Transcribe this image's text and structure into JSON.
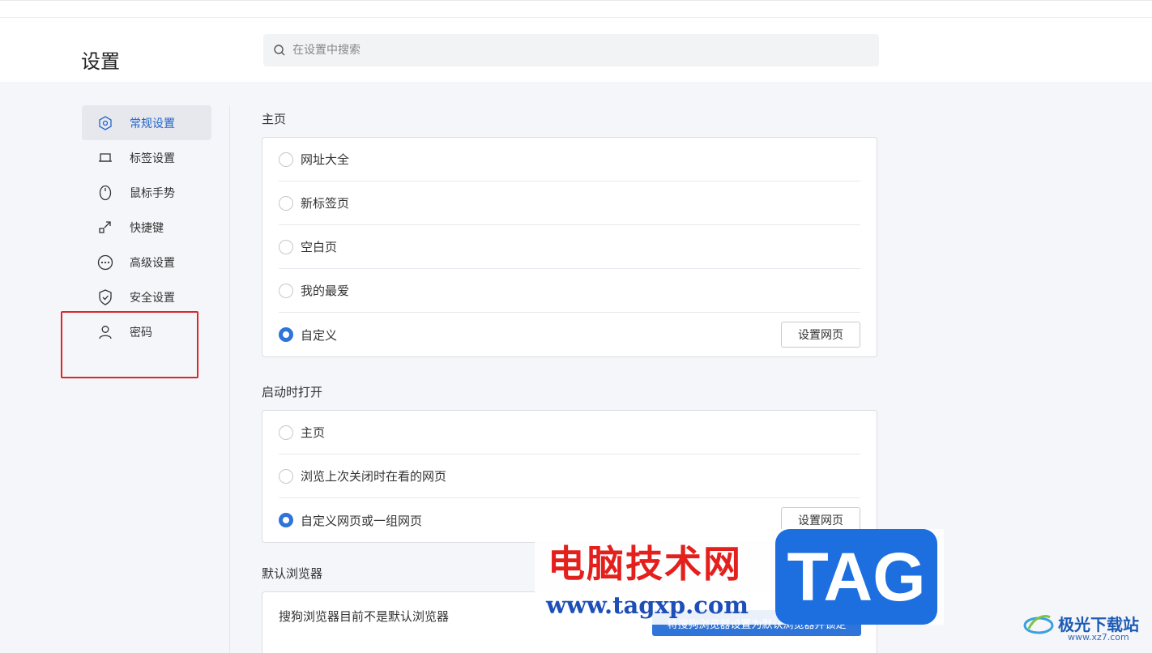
{
  "header": {
    "title": "设置",
    "search_placeholder": "在设置中搜索"
  },
  "sidebar": {
    "items": [
      {
        "label": "常规设置",
        "icon": "settings-hexagon-icon",
        "active": true
      },
      {
        "label": "标签设置",
        "icon": "tab-icon"
      },
      {
        "label": "鼠标手势",
        "icon": "mouse-icon"
      },
      {
        "label": "快捷键",
        "icon": "shortcut-icon"
      },
      {
        "label": "高级设置",
        "icon": "more-circle-icon"
      },
      {
        "label": "安全设置",
        "icon": "shield-icon"
      },
      {
        "label": "密码",
        "icon": "user-icon"
      }
    ]
  },
  "homepage": {
    "title": "主页",
    "options": [
      "网址大全",
      "新标签页",
      "空白页",
      "我的最爱",
      "自定义"
    ],
    "selected": "自定义",
    "button": "设置网页"
  },
  "startup": {
    "title": "启动时打开",
    "options": [
      "主页",
      "浏览上次关闭时在看的网页",
      "自定义网页或一组网页"
    ],
    "selected": "自定义网页或一组网页",
    "button": "设置网页"
  },
  "default_browser": {
    "title": "默认浏览器",
    "status": "搜狗浏览器目前不是默认浏览器",
    "button": "将搜狗浏览器设置为默认浏览器并锁定"
  },
  "watermark": {
    "cn": "电脑技术网",
    "url": "www.tagxp.com",
    "tag": "TAG",
    "corner": "极光下载站",
    "corner_url": "www.xz7.com"
  },
  "colors": {
    "accent": "#2f74d8",
    "highlight": "#e0242a"
  }
}
